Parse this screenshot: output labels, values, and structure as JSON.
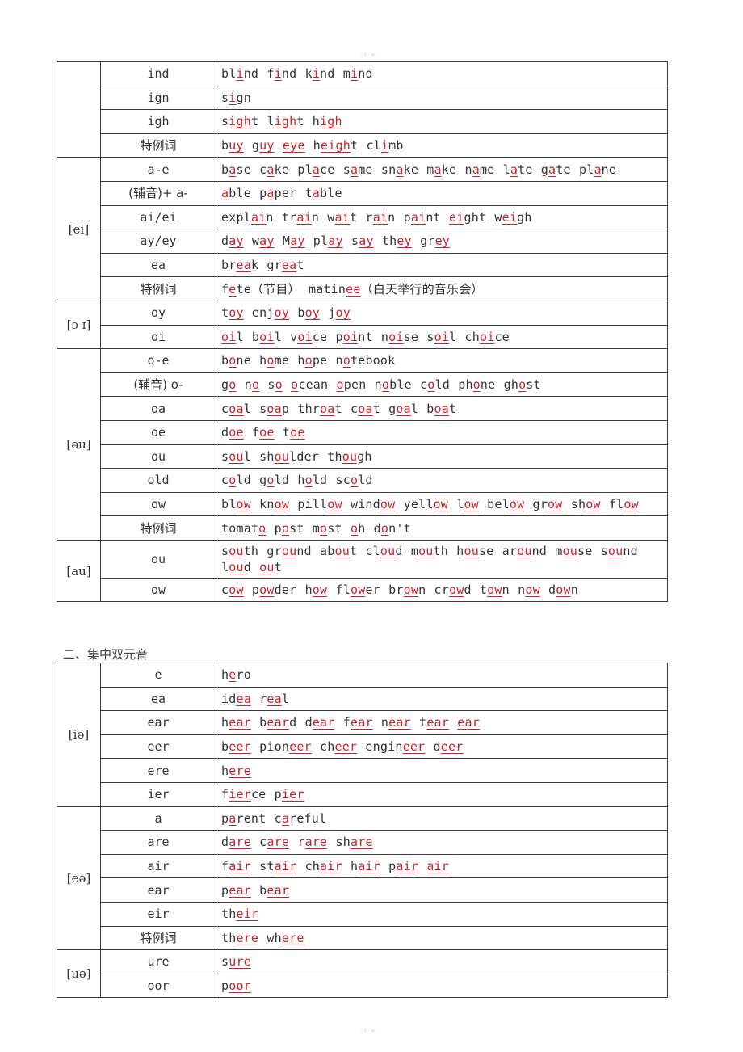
{
  "header_watermark": "·ı·ʉ··",
  "footer_watermark": "·ı·ʉ··",
  "colors": {
    "text": "#333333",
    "highlight": "#d0212a",
    "border": "#3a3a3a"
  },
  "table1": {
    "groups": [
      {
        "sound": "",
        "rows": [
          {
            "spelling": "ind",
            "words": "bl[i]nd f[i]nd k[i]nd m[i]nd"
          },
          {
            "spelling": "ign",
            "words": "s[i]gn"
          },
          {
            "spelling": "igh",
            "words": "s[igh]t l[igh]t h[igh]"
          },
          {
            "spelling": "特例词",
            "words": "b[uy] g[uy] [eye] h[eigh]t cl[i]mb"
          }
        ]
      },
      {
        "sound": "[ei]",
        "rows": [
          {
            "spelling": "a-e",
            "words": "b[a]se c[a]ke pl[a]ce s[a]me sn[a]ke m[a]ke n[a]me l[a]te g[a]te pl[a]ne"
          },
          {
            "spelling": "(辅音)+ a-",
            "words": "[a]ble p[a]per t[a]ble"
          },
          {
            "spelling": "ai/ei",
            "words": "expl[ai]n tr[ai]n w[ai]t r[ai]n p[ai]nt [ei]ght w[ei]gh"
          },
          {
            "spelling": "ay/ey",
            "words": "d[ay] w[ay] M[ay] pl[ay] s[ay] th[ey] gr[ey]"
          },
          {
            "spelling": "ea",
            "words": "br[ea]k gr[ea]t"
          },
          {
            "spelling": "特例词",
            "words": "f[e]te（节目） matin[ee]（白天举行的音乐会）"
          }
        ]
      },
      {
        "sound": "[ɔ ɪ]",
        "rows": [
          {
            "spelling": "oy",
            "words": "t[oy] enj[oy] b[oy] j[oy]"
          },
          {
            "spelling": "oi",
            "words": "[oi]l b[oi]l v[oi]ce p[oi]nt n[oi]se s[oi]l ch[oi]ce"
          }
        ]
      },
      {
        "sound": "[əu]",
        "rows": [
          {
            "spelling": "o-e",
            "words": "b[o]ne h[o]me h[o]pe n[o]tebook"
          },
          {
            "spelling": "(辅音) o-",
            "words": "g[o] n[o] s[o] [o]cean [o]pen n[o]ble c[o]ld ph[o]ne gh[o]st"
          },
          {
            "spelling": "oa",
            "words": "c[oa]l s[oa]p thr[oa]t c[oa]t g[oa]l b[oa]t"
          },
          {
            "spelling": "oe",
            "words": "d[oe] f[oe] t[oe]"
          },
          {
            "spelling": "ou",
            "words": "s[ou]l sh[ou]lder th[ou]gh"
          },
          {
            "spelling": "old",
            "words": "c[o]ld g[o]ld h[o]ld sc[o]ld"
          },
          {
            "spelling": "ow",
            "words": "bl[ow] kn[ow] pill[ow] wind[ow] yell[ow] l[ow] bel[ow] gr[ow] sh[ow] fl[ow]"
          },
          {
            "spelling": "特例词",
            "words": "tomat[o] p[o]st m[o]st [o]h d[o]n't"
          }
        ]
      },
      {
        "sound": "[au]",
        "rows": [
          {
            "spelling": "ou",
            "words": "s[ou]th gr[ou]nd ab[ou]t cl[ou]d m[ou]th h[ou]se ar[ou]nd m[ou]se s[ou]nd l[ou]d [ou]t"
          },
          {
            "spelling": "ow",
            "words": "c[ow] p[ow]der h[ow] fl[ow]er br[ow]n cr[ow]d t[ow]n n[ow] d[ow]n"
          }
        ]
      }
    ]
  },
  "section2": {
    "title": "二、集中双元音"
  },
  "table2": {
    "groups": [
      {
        "sound": "[iə]",
        "rows": [
          {
            "spelling": "e",
            "words": "h[e]ro"
          },
          {
            "spelling": "ea",
            "words": "id[ea] r[ea]l"
          },
          {
            "spelling": "ear",
            "words": "h[ear] b[ear]d d[ear] f[ear] n[ear] t[ear] [ear]"
          },
          {
            "spelling": "eer",
            "words": "b[eer] pion[eer] ch[eer] engin[eer] d[eer]"
          },
          {
            "spelling": "ere",
            "words": "h[ere]"
          },
          {
            "spelling": "ier",
            "words": "f[ier]ce p[ier]"
          }
        ]
      },
      {
        "sound": "[eə]",
        "rows": [
          {
            "spelling": "a",
            "words": "p[a]rent c[a]reful"
          },
          {
            "spelling": "are",
            "words": "d[are] c[are] r[are] sh[are]"
          },
          {
            "spelling": "air",
            "words": "f[air] st[air] ch[air] h[air] p[air] [air]"
          },
          {
            "spelling": "ear",
            "words": "p[ear] b[ear]"
          },
          {
            "spelling": "eir",
            "words": "th[eir]"
          },
          {
            "spelling": "特例词",
            "words": "th[ere] wh[ere]"
          }
        ]
      },
      {
        "sound": "[uə]",
        "rows": [
          {
            "spelling": "ure",
            "words": "s[ure]"
          },
          {
            "spelling": "oor",
            "words": "p[oor]"
          }
        ]
      }
    ]
  }
}
